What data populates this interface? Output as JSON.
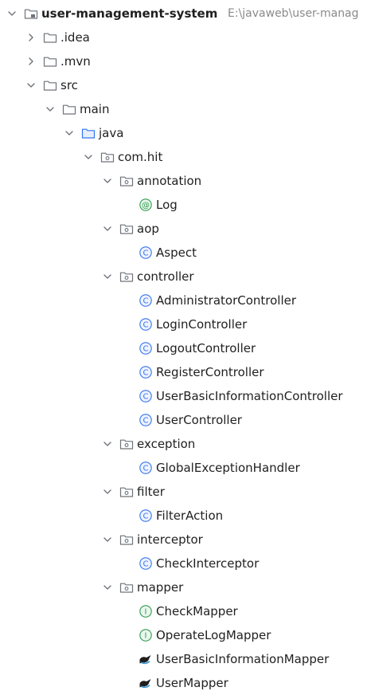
{
  "colors": {
    "text": "#1f1f1f",
    "muted": "#8a8a8a",
    "folder": "#6f737a",
    "source_folder": "#3574f0",
    "class_icon": "#3574f0",
    "interface_icon": "#2e9c4b",
    "annotation_icon": "#2e9c4b"
  },
  "tree": [
    {
      "label": "user-management-system",
      "bold": true,
      "extra": "E:\\javaweb\\user-manag",
      "depth": 0,
      "toggle": "expanded",
      "icon": "module-folder-icon",
      "name": "root-module"
    },
    {
      "label": ".idea",
      "depth": 1,
      "toggle": "collapsed",
      "icon": "folder-icon",
      "name": "folder-idea"
    },
    {
      "label": ".mvn",
      "depth": 1,
      "toggle": "collapsed",
      "icon": "folder-icon",
      "name": "folder-mvn"
    },
    {
      "label": "src",
      "depth": 1,
      "toggle": "expanded",
      "icon": "folder-icon",
      "name": "folder-src"
    },
    {
      "label": "main",
      "depth": 2,
      "toggle": "expanded",
      "icon": "folder-icon",
      "name": "folder-main"
    },
    {
      "label": "java",
      "depth": 3,
      "toggle": "expanded",
      "icon": "source-folder-icon",
      "name": "folder-java"
    },
    {
      "label": "com.hit",
      "depth": 4,
      "toggle": "expanded",
      "icon": "package-icon",
      "name": "package-com-hit"
    },
    {
      "label": "annotation",
      "depth": 5,
      "toggle": "expanded",
      "icon": "package-icon",
      "name": "package-annotation"
    },
    {
      "label": "Log",
      "depth": 6,
      "toggle": "none",
      "icon": "annotation-icon",
      "name": "file-log"
    },
    {
      "label": "aop",
      "depth": 5,
      "toggle": "expanded",
      "icon": "package-icon",
      "name": "package-aop"
    },
    {
      "label": "Aspect",
      "depth": 6,
      "toggle": "none",
      "icon": "class-icon",
      "name": "file-aspect"
    },
    {
      "label": "controller",
      "depth": 5,
      "toggle": "expanded",
      "icon": "package-icon",
      "name": "package-controller"
    },
    {
      "label": "AdministratorController",
      "depth": 6,
      "toggle": "none",
      "icon": "class-icon",
      "name": "file-administrator-controller"
    },
    {
      "label": "LoginController",
      "depth": 6,
      "toggle": "none",
      "icon": "class-icon",
      "name": "file-login-controller"
    },
    {
      "label": "LogoutController",
      "depth": 6,
      "toggle": "none",
      "icon": "class-icon",
      "name": "file-logout-controller"
    },
    {
      "label": "RegisterController",
      "depth": 6,
      "toggle": "none",
      "icon": "class-icon",
      "name": "file-register-controller"
    },
    {
      "label": "UserBasicInformationController",
      "depth": 6,
      "toggle": "none",
      "icon": "class-icon",
      "name": "file-user-basic-information-controller"
    },
    {
      "label": "UserController",
      "depth": 6,
      "toggle": "none",
      "icon": "class-icon",
      "name": "file-user-controller"
    },
    {
      "label": "exception",
      "depth": 5,
      "toggle": "expanded",
      "icon": "package-icon",
      "name": "package-exception"
    },
    {
      "label": "GlobalExceptionHandler",
      "depth": 6,
      "toggle": "none",
      "icon": "class-icon",
      "name": "file-global-exception-handler"
    },
    {
      "label": "filter",
      "depth": 5,
      "toggle": "expanded",
      "icon": "package-icon",
      "name": "package-filter"
    },
    {
      "label": "FilterAction",
      "depth": 6,
      "toggle": "none",
      "icon": "class-icon",
      "name": "file-filter-action"
    },
    {
      "label": "interceptor",
      "depth": 5,
      "toggle": "expanded",
      "icon": "package-icon",
      "name": "package-interceptor"
    },
    {
      "label": "CheckInterceptor",
      "depth": 6,
      "toggle": "none",
      "icon": "class-icon",
      "name": "file-check-interceptor"
    },
    {
      "label": "mapper",
      "depth": 5,
      "toggle": "expanded",
      "icon": "package-icon",
      "name": "package-mapper"
    },
    {
      "label": "CheckMapper",
      "depth": 6,
      "toggle": "none",
      "icon": "interface-icon",
      "name": "file-check-mapper"
    },
    {
      "label": "OperateLogMapper",
      "depth": 6,
      "toggle": "none",
      "icon": "interface-icon",
      "name": "file-operate-log-mapper"
    },
    {
      "label": "UserBasicInformationMapper",
      "depth": 6,
      "toggle": "none",
      "icon": "mybatis-mapper-icon",
      "name": "file-user-basic-information-mapper"
    },
    {
      "label": "UserMapper",
      "depth": 6,
      "toggle": "none",
      "icon": "mybatis-mapper-icon",
      "name": "file-user-mapper"
    }
  ]
}
